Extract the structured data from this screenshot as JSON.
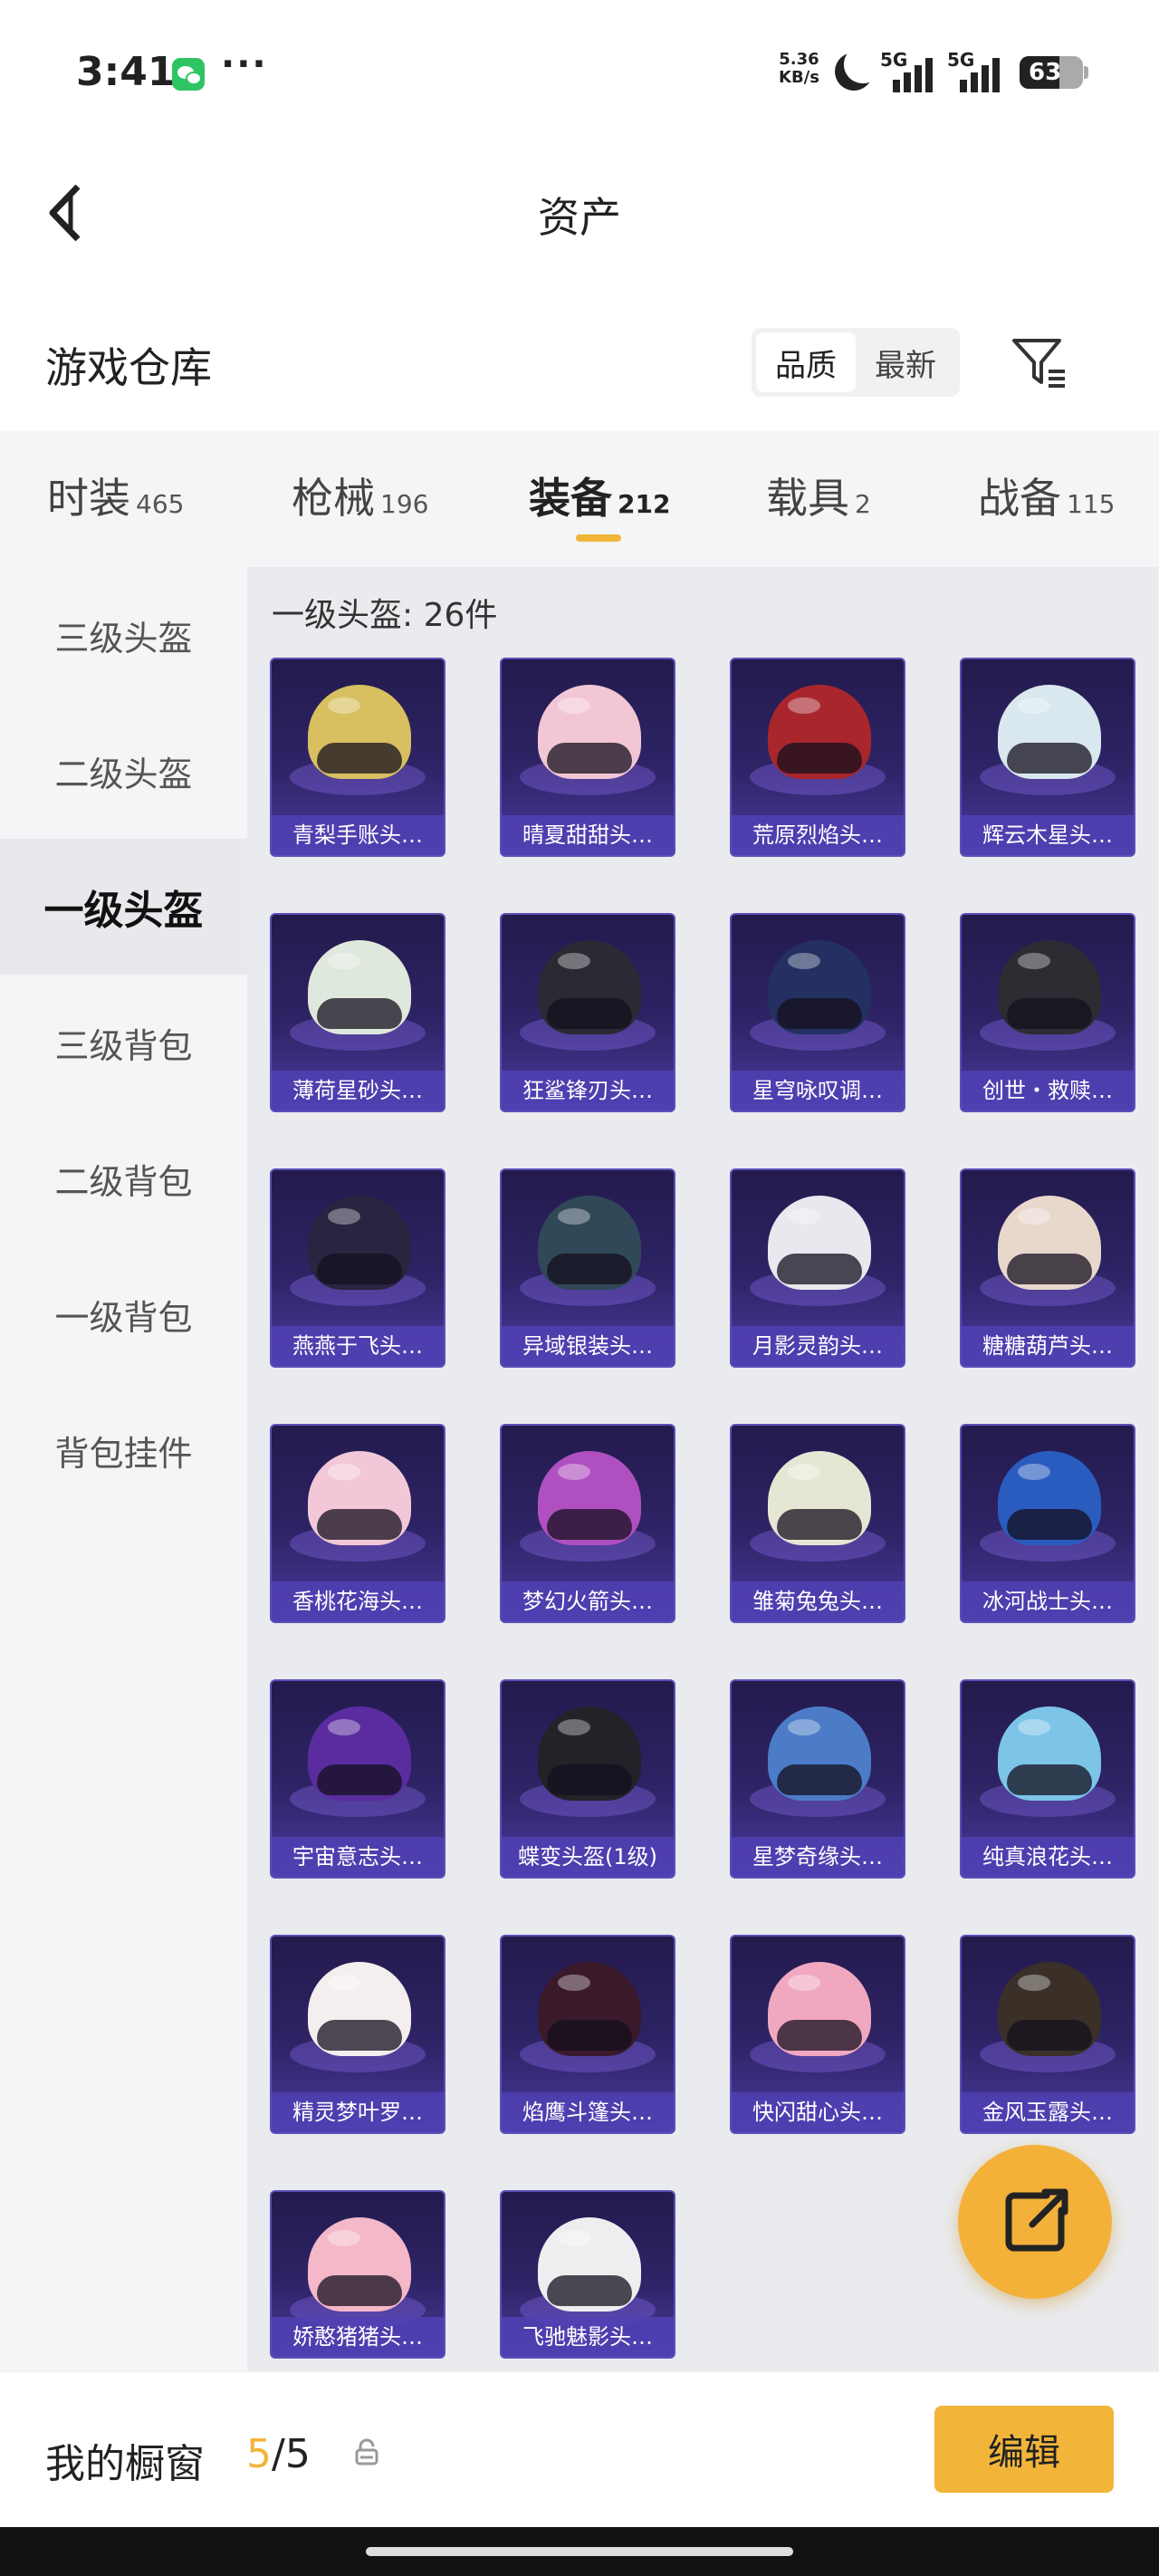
{
  "status_bar": {
    "time": "3:41",
    "net_speed_value": "5.36",
    "net_speed_unit": "KB/s",
    "sig1": "5G",
    "sig2": "5G",
    "battery": "63"
  },
  "header": {
    "title": "资产"
  },
  "section": {
    "title": "游戏仓库",
    "sort_options": [
      "品质",
      "最新"
    ]
  },
  "tabs": [
    {
      "name": "时装",
      "count": "465"
    },
    {
      "name": "枪械",
      "count": "196"
    },
    {
      "name": "装备",
      "count": "212"
    },
    {
      "name": "载具",
      "count": "2"
    },
    {
      "name": "战备",
      "count": "115"
    }
  ],
  "sidebar": {
    "items": [
      "三级头盔",
      "二级头盔",
      "一级头盔",
      "三级背包",
      "二级背包",
      "一级背包",
      "背包挂件"
    ]
  },
  "content": {
    "header": "一级头盔: 26件",
    "items": [
      "青梨手账头…",
      "晴夏甜甜头…",
      "荒原烈焰头…",
      "辉云木星头…",
      "薄荷星砂头…",
      "狂鲨锋刃头…",
      "星穹咏叹调…",
      "创世・救赎…",
      "燕燕于飞头…",
      "异域银装头…",
      "月影灵韵头…",
      "糖糖葫芦头…",
      "香桃花海头…",
      "梦幻火箭头…",
      "雏菊兔兔头…",
      "冰河战士头…",
      "宇宙意志头…",
      "蝶变头盔(1级)",
      "星梦奇缘头…",
      "纯真浪花头…",
      "精灵梦叶罗…",
      "焰鹰斗篷头…",
      "快闪甜心头…",
      "金风玉露头…",
      "娇憨猪猪头…",
      "飞驰魅影头…"
    ],
    "helmet_colors": [
      "#d8c060",
      "#f2c6d4",
      "#a8262c",
      "#d8e8ee",
      "#dfe8dc",
      "#2a2a34",
      "#243062",
      "#2c2c32",
      "#2a2440",
      "#304858",
      "#e8e8ee",
      "#e8d8cc",
      "#f2c8d8",
      "#b050c0",
      "#e6e6d4",
      "#2a5cc0",
      "#5a2ca0",
      "#222228",
      "#4c7cc8",
      "#7cc4e8",
      "#f4eeee",
      "#3a1a2a",
      "#f0a8c0",
      "#3a3028",
      "#f4b8c8",
      "#eeeef0"
    ]
  },
  "fab": {
    "icon": "share-icon"
  },
  "bottom": {
    "showcase_label": "我的橱窗",
    "showcase_current": "5",
    "showcase_total": "/5",
    "edit_label": "编辑"
  },
  "colors": {
    "accent": "#f2b53a",
    "card_bg": "#2e2466",
    "card_label_bg": "#5041b4"
  }
}
